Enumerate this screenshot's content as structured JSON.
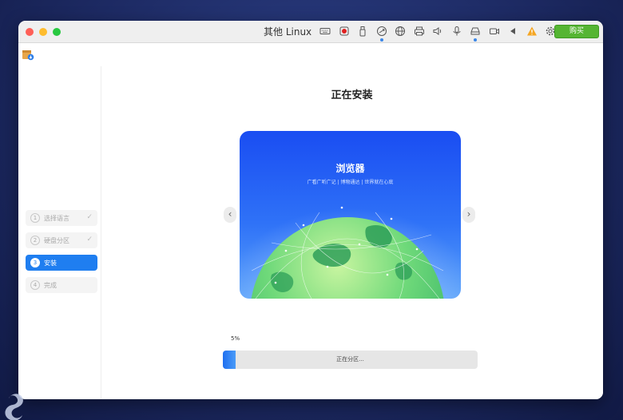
{
  "window": {
    "vm_name": "其他 Linux",
    "buy_label": "购买",
    "toolbar_icons": [
      "keyboard-icon",
      "record-icon",
      "usb-icon",
      "sync-icon",
      "globe-icon",
      "printer-icon",
      "speaker-icon",
      "microphone-icon",
      "drive-icon",
      "camera-icon",
      "play-icon",
      "warning-icon",
      "gear-icon"
    ],
    "colors": {
      "buy": "#55b533",
      "warning": "#f5a623",
      "record": "#e02020"
    }
  },
  "sidebar": {
    "steps": [
      {
        "num": "1",
        "label": "选择语言",
        "done": true
      },
      {
        "num": "2",
        "label": "硬盘分区",
        "done": true
      },
      {
        "num": "3",
        "label": "安装",
        "active": true
      },
      {
        "num": "4",
        "label": "完成"
      }
    ],
    "check": "✓"
  },
  "main": {
    "title": "正在安装",
    "slide": {
      "title": "浏览器",
      "subtitle": "广看广听广记 | 博物通达 | 世界就在心底"
    },
    "prev": "‹",
    "next": "›",
    "progress": {
      "percent_label": "5%",
      "value": 0.05,
      "status": "正在分区..."
    }
  },
  "accent": "#1f7ef0"
}
